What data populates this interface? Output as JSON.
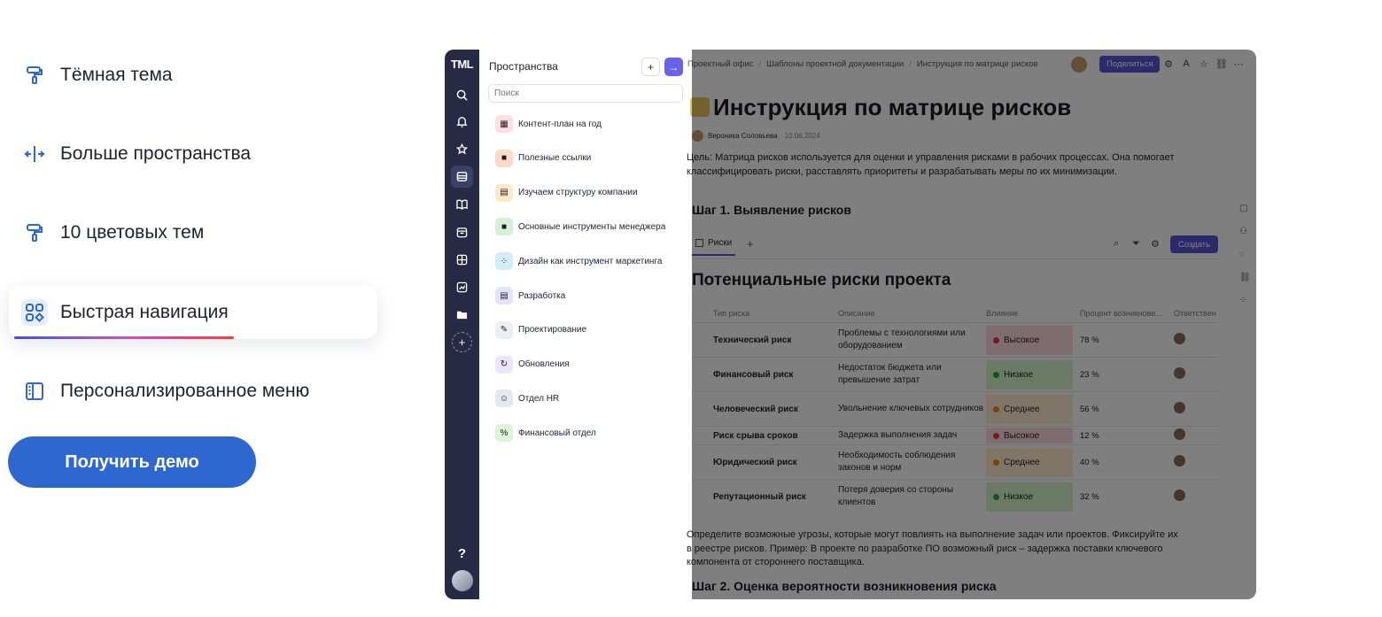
{
  "features": [
    {
      "label": "Тёмная тема",
      "icon": "paint-roller-icon"
    },
    {
      "label": "Больше пространства",
      "icon": "expand-horizontal-icon"
    },
    {
      "label": "10 цветовых тем",
      "icon": "paint-roller-icon"
    },
    {
      "label": "Быстрая навигация",
      "icon": "grid-navigation-icon"
    },
    {
      "label": "Персонализированное меню",
      "icon": "sidebar-layout-icon"
    }
  ],
  "demo_button": "Получить демо",
  "colors": {
    "accent": "#2f67d1",
    "rail": "#272a45",
    "purple": "#5a54d8"
  },
  "app": {
    "logo": "TML",
    "help": "?",
    "spaces_panel": {
      "title": "Пространства",
      "add": "+",
      "go": "→",
      "search_placeholder": "Поиск",
      "items": [
        {
          "label": "Контент-план на год",
          "icon": "calendar-icon",
          "color": "#ffdfe3",
          "glyph": "▦"
        },
        {
          "label": "Полезные ссылки",
          "icon": "folder-icon",
          "color": "#ffd9c9",
          "glyph": "■"
        },
        {
          "label": "Изучаем структуру компании",
          "icon": "clipboard-icon",
          "color": "#ffe9c7",
          "glyph": "▤"
        },
        {
          "label": "Основные инструменты менеджера",
          "icon": "folder-icon",
          "color": "#d5efd8",
          "glyph": "■"
        },
        {
          "label": "Дизайн как инструмент маркетинга",
          "icon": "design-icon",
          "color": "#d3ecf7",
          "glyph": "⁘"
        },
        {
          "label": "Разработка",
          "icon": "board-icon",
          "color": "#e3e4fb",
          "glyph": "▤"
        },
        {
          "label": "Проектирование",
          "icon": "pencil-icon",
          "color": "#eceef2",
          "glyph": "✎"
        },
        {
          "label": "Обновления",
          "icon": "refresh-icon",
          "color": "#ece6fb",
          "glyph": "↻"
        },
        {
          "label": "Отдел HR",
          "icon": "user-icon",
          "color": "#e6e8f0",
          "glyph": "☺"
        },
        {
          "label": "Финансовый отдел",
          "icon": "percent-icon",
          "color": "#dff3d6",
          "glyph": "%"
        }
      ]
    },
    "breadcrumbs": [
      "Проектный офис",
      "Шаблоны проектной документации",
      "Инструкция по матрице рисков"
    ],
    "share": "Поделиться",
    "doc": {
      "title": "Инструкция по матрице рисков",
      "author": "Вероника Соловьева",
      "date": "10.06.2024",
      "intro": "Цель: Матрица рисков используется для оценки и управления рисками в рабочих процессах. Она помогает классифицировать риски, расставлять приоритеты и разрабатывать меры по их минимизации.",
      "step1": "Шаг 1. Выявление рисков",
      "tab": "Риски",
      "tab_add": "+",
      "create": "Создать",
      "table_title": "Потенциальные риски проекта",
      "columns": [
        "Тип риска",
        "Описание",
        "Влияние",
        "Процент возникнове...",
        "Ответствен"
      ],
      "rows": [
        {
          "type": "Технический риск",
          "desc": "Проблемы с технологиями или оборудованием",
          "impact": "Высокое",
          "level": "high",
          "pct": "78 %"
        },
        {
          "type": "Финансовый риск",
          "desc": "Недостаток бюджета или превышение затрат",
          "impact": "Низкое",
          "level": "low",
          "pct": "23 %"
        },
        {
          "type": "Человеческий риск",
          "desc": "Увольнение ключевых сотрудников",
          "impact": "Среднее",
          "level": "mid",
          "pct": "56 %"
        },
        {
          "type": "Риск срыва сроков",
          "desc": "Задержка выполнения задач",
          "impact": "Высокое",
          "level": "high",
          "pct": "12 %"
        },
        {
          "type": "Юридический риск",
          "desc": "Необходимость соблюдения законов и норм",
          "impact": "Среднее",
          "level": "mid",
          "pct": "40 %"
        },
        {
          "type": "Репутационный риск",
          "desc": "Потеря доверия со стороны клиентов",
          "impact": "Низкое",
          "level": "low",
          "pct": "32 %"
        }
      ],
      "outro": "Определите возможные угрозы, которые могут повлиять на выполнение задач или проектов. Фиксируйте их в реестре рисков. Пример: В проекте по разработке ПО возможный риск – задержка поставки ключевого компонента от стороннего поставщика.",
      "step2": "Шаг 2. Оценка вероятности возникновения риска"
    }
  }
}
